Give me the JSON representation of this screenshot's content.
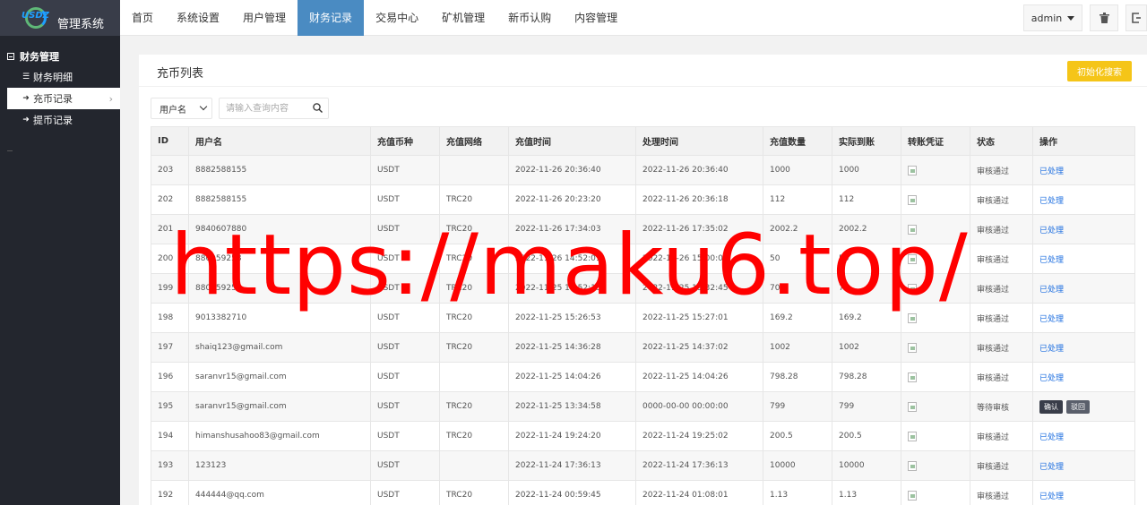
{
  "app": {
    "logo_text": "USDZ",
    "title": "管理系统"
  },
  "sidebar": {
    "group_title": "财务管理",
    "items": [
      {
        "label": "财务明细",
        "icon": "list-icon"
      },
      {
        "label": "充币记录",
        "icon": "sign-in-icon"
      },
      {
        "label": "提币记录",
        "icon": "sign-out-icon"
      }
    ]
  },
  "topnav": {
    "items": [
      {
        "label": "首页"
      },
      {
        "label": "系统设置"
      },
      {
        "label": "用户管理"
      },
      {
        "label": "财务记录"
      },
      {
        "label": "交易中心"
      },
      {
        "label": "矿机管理"
      },
      {
        "label": "新币认购"
      },
      {
        "label": "内容管理"
      }
    ],
    "active": "财务记录",
    "user": "admin"
  },
  "panel": {
    "title": "充币列表",
    "init_search_label": "初始化搜索",
    "filter_select_value": "用户名",
    "search_placeholder": "请输入查询内容"
  },
  "table": {
    "headers": {
      "id": "ID",
      "user": "用户名",
      "coin": "充值币种",
      "network": "充值网络",
      "time": "充值时间",
      "processed": "处理时间",
      "amount": "充值数量",
      "received": "实际到账",
      "proof": "转账凭证",
      "status": "状态",
      "op": "操作"
    },
    "rows": [
      {
        "id": "203",
        "user": "8882588155",
        "coin": "USDT",
        "network": "",
        "time": "2022-11-26 20:36:40",
        "processed": "2022-11-26 20:36:40",
        "amount": "1000",
        "received": "1000",
        "status": "审核通过",
        "op": "已处理"
      },
      {
        "id": "202",
        "user": "8882588155",
        "coin": "USDT",
        "network": "TRC20",
        "time": "2022-11-26 20:23:20",
        "processed": "2022-11-26 20:36:18",
        "amount": "112",
        "received": "112",
        "status": "审核通过",
        "op": "已处理"
      },
      {
        "id": "201",
        "user": "9840607880",
        "coin": "USDT",
        "network": "TRC20",
        "time": "2022-11-26 17:34:03",
        "processed": "2022-11-26 17:35:02",
        "amount": "2002.2",
        "received": "2002.2",
        "status": "审核通过",
        "op": "已处理"
      },
      {
        "id": "200",
        "user": "880059258",
        "coin": "USDT",
        "network": "TRC20",
        "time": "2022-11-26 14:52:01",
        "processed": "2022-11-26 15:00:06",
        "amount": "50",
        "received": "50",
        "status": "审核通过",
        "op": "已处理"
      },
      {
        "id": "199",
        "user": "880059258",
        "coin": "USDT",
        "network": "TRC20",
        "time": "2022-11-25 18:52:13",
        "processed": "2022-11-25 19:32:45",
        "amount": "70",
        "received": "70",
        "status": "审核通过",
        "op": "已处理"
      },
      {
        "id": "198",
        "user": "9013382710",
        "coin": "USDT",
        "network": "TRC20",
        "time": "2022-11-25 15:26:53",
        "processed": "2022-11-25 15:27:01",
        "amount": "169.2",
        "received": "169.2",
        "status": "审核通过",
        "op": "已处理"
      },
      {
        "id": "197",
        "user": "shaiq123@gmail.com",
        "coin": "USDT",
        "network": "TRC20",
        "time": "2022-11-25 14:36:28",
        "processed": "2022-11-25 14:37:02",
        "amount": "1002",
        "received": "1002",
        "status": "审核通过",
        "op": "已处理"
      },
      {
        "id": "196",
        "user": "saranvr15@gmail.com",
        "coin": "USDT",
        "network": "",
        "time": "2022-11-25 14:04:26",
        "processed": "2022-11-25 14:04:26",
        "amount": "798.28",
        "received": "798.28",
        "status": "审核通过",
        "op": "已处理"
      },
      {
        "id": "195",
        "user": "saranvr15@gmail.com",
        "coin": "USDT",
        "network": "TRC20",
        "time": "2022-11-25 13:34:58",
        "processed": "0000-00-00 00:00:00",
        "amount": "799",
        "received": "799",
        "status": "等待审核",
        "op": "",
        "confirm_label": "确认",
        "reject_label": "驳回"
      },
      {
        "id": "194",
        "user": "himanshusahoo83@gmail.com",
        "coin": "USDT",
        "network": "TRC20",
        "time": "2022-11-24 19:24:20",
        "processed": "2022-11-24 19:25:02",
        "amount": "200.5",
        "received": "200.5",
        "status": "审核通过",
        "op": "已处理"
      },
      {
        "id": "193",
        "user": "123123",
        "coin": "USDT",
        "network": "",
        "time": "2022-11-24 17:36:13",
        "processed": "2022-11-24 17:36:13",
        "amount": "10000",
        "received": "10000",
        "status": "审核通过",
        "op": "已处理"
      },
      {
        "id": "192",
        "user": "444444@qq.com",
        "coin": "USDT",
        "network": "TRC20",
        "time": "2022-11-24 00:59:45",
        "processed": "2022-11-24 01:08:01",
        "amount": "1.13",
        "received": "1.13",
        "status": "审核通过",
        "op": "已处理"
      }
    ]
  },
  "watermark": "https://maku6.top/",
  "colors": {
    "sidebar_bg": "#23262e",
    "logo_bg": "#393d49",
    "active_tab": "#4a8bc2",
    "status_ok": "#009688",
    "status_wait": "#1e9fff",
    "init_button": "#f5c518",
    "watermark": "#ff0000"
  }
}
